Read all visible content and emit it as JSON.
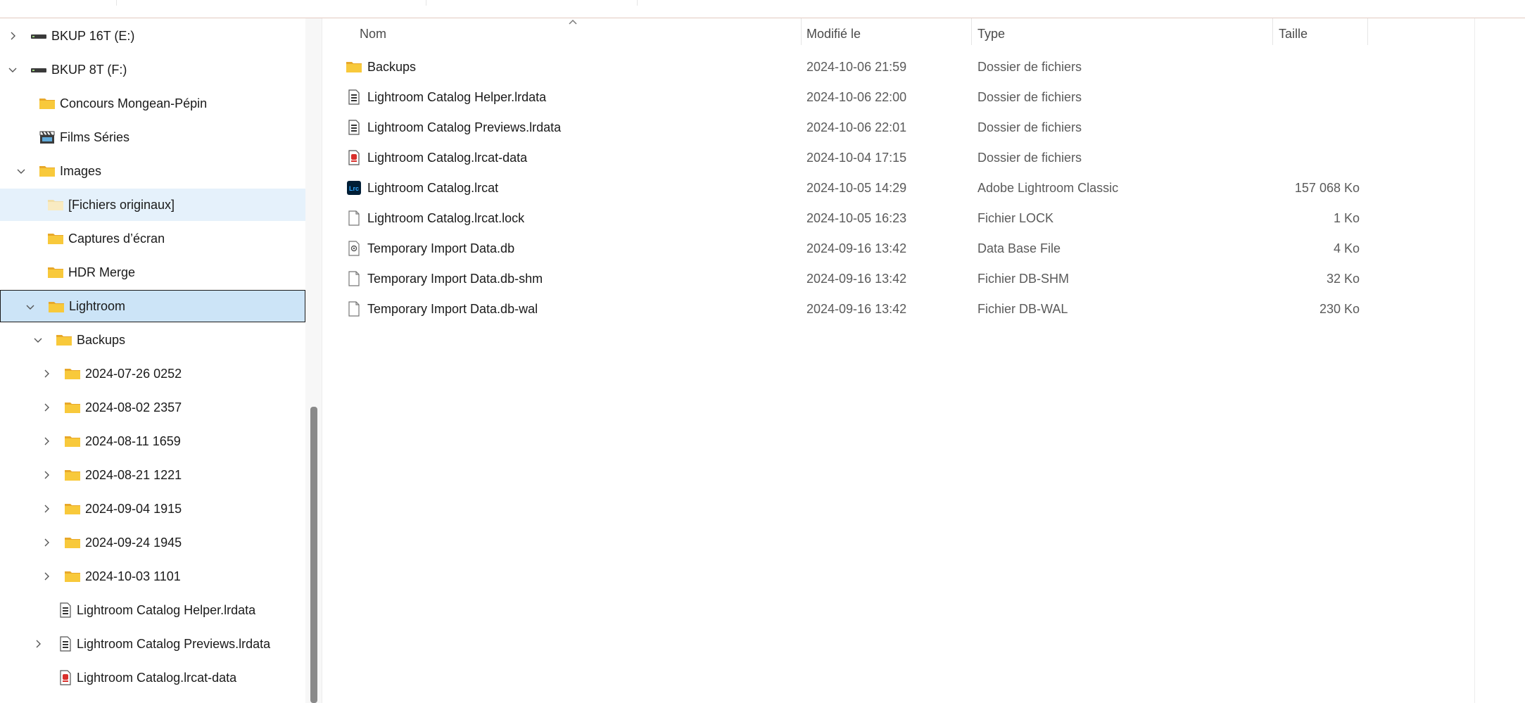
{
  "nav": {
    "items": [
      {
        "label": "BKUP 16T (E:)",
        "icon": "drive-icon",
        "chevron": "right"
      },
      {
        "label": "BKUP 8T (F:)",
        "icon": "drive-icon",
        "chevron": "down"
      },
      {
        "label": "Concours Mongean-Pépin",
        "icon": "folder-icon",
        "chevron": ""
      },
      {
        "label": "Films Séries",
        "icon": "clapperboard-icon",
        "chevron": ""
      },
      {
        "label": "Images",
        "icon": "folder-icon",
        "chevron": "down"
      },
      {
        "label": "[Fichiers originaux]",
        "icon": "folder-pale-icon",
        "chevron": ""
      },
      {
        "label": "Captures d’écran",
        "icon": "folder-icon",
        "chevron": ""
      },
      {
        "label": "HDR Merge",
        "icon": "folder-icon",
        "chevron": ""
      },
      {
        "label": "Lightroom",
        "icon": "folder-icon",
        "chevron": "down"
      },
      {
        "label": "Backups",
        "icon": "folder-icon",
        "chevron": "down"
      },
      {
        "label": "2024-07-26 0252",
        "icon": "folder-icon",
        "chevron": "right"
      },
      {
        "label": "2024-08-02 2357",
        "icon": "folder-icon",
        "chevron": "right"
      },
      {
        "label": "2024-08-11 1659",
        "icon": "folder-icon",
        "chevron": "right"
      },
      {
        "label": "2024-08-21 1221",
        "icon": "folder-icon",
        "chevron": "right"
      },
      {
        "label": "2024-09-04 1915",
        "icon": "folder-icon",
        "chevron": "right"
      },
      {
        "label": "2024-09-24 1945",
        "icon": "folder-icon",
        "chevron": "right"
      },
      {
        "label": "2024-10-03 1101",
        "icon": "folder-icon",
        "chevron": "right"
      },
      {
        "label": "Lightroom Catalog Helper.lrdata",
        "icon": "lrdata-icon",
        "chevron": ""
      },
      {
        "label": "Lightroom Catalog Previews.lrdata",
        "icon": "lrdata-icon",
        "chevron": "right"
      },
      {
        "label": "Lightroom Catalog.lrcat-data",
        "icon": "lrcat-data-icon",
        "chevron": ""
      }
    ]
  },
  "columns": {
    "name": "Nom",
    "modified": "Modifié le",
    "type": "Type",
    "size": "Taille"
  },
  "files": [
    {
      "name": "Backups",
      "modified": "2024-10-06 21:59",
      "type": "Dossier de fichiers",
      "size": "",
      "icon": "folder-icon"
    },
    {
      "name": "Lightroom Catalog Helper.lrdata",
      "modified": "2024-10-06 22:00",
      "type": "Dossier de fichiers",
      "size": "",
      "icon": "lrdata-icon"
    },
    {
      "name": "Lightroom Catalog Previews.lrdata",
      "modified": "2024-10-06 22:01",
      "type": "Dossier de fichiers",
      "size": "",
      "icon": "lrdata-icon"
    },
    {
      "name": "Lightroom Catalog.lrcat-data",
      "modified": "2024-10-04 17:15",
      "type": "Dossier de fichiers",
      "size": "",
      "icon": "lrcat-data-icon"
    },
    {
      "name": "Lightroom Catalog.lrcat",
      "modified": "2024-10-05 14:29",
      "type": "Adobe Lightroom Classic",
      "size": "157 068 Ko",
      "icon": "lightroom-classic-icon"
    },
    {
      "name": "Lightroom Catalog.lrcat.lock",
      "modified": "2024-10-05 16:23",
      "type": "Fichier LOCK",
      "size": "1 Ko",
      "icon": "blank-file-icon"
    },
    {
      "name": "Temporary Import Data.db",
      "modified": "2024-09-16 13:42",
      "type": "Data Base File",
      "size": "4 Ko",
      "icon": "db-file-icon"
    },
    {
      "name": "Temporary Import Data.db-shm",
      "modified": "2024-09-16 13:42",
      "type": "Fichier DB-SHM",
      "size": "32 Ko",
      "icon": "blank-file-icon"
    },
    {
      "name": "Temporary Import Data.db-wal",
      "modified": "2024-09-16 13:42",
      "type": "Fichier DB-WAL",
      "size": "230 Ko",
      "icon": "blank-file-icon"
    }
  ],
  "colors": {
    "selection": "#cce4f7",
    "hover": "#e5f1fb",
    "folder": "#f8c93b",
    "lightroom": "#001e36"
  }
}
